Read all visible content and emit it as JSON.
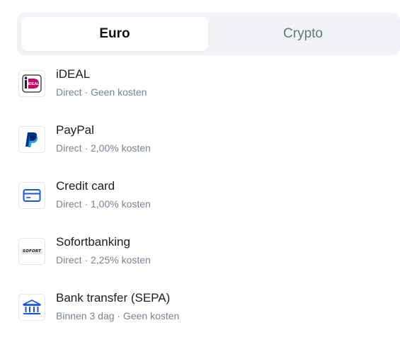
{
  "tabs": {
    "euro": "Euro",
    "crypto": "Crypto",
    "active": "Euro"
  },
  "methods": [
    {
      "title": "iDEAL",
      "subtitle": "Direct · Geen kosten",
      "icon": "ideal-icon",
      "icon_text": "iDEAL"
    },
    {
      "title": "PayPal",
      "subtitle": "Direct · 2,00% kosten",
      "icon": "paypal-icon"
    },
    {
      "title": "Credit card",
      "subtitle": "Direct · 1,00% kosten",
      "icon": "credit-card-icon"
    },
    {
      "title": "Sofortbanking",
      "subtitle": "Direct · 2,25% kosten",
      "icon": "sofort-icon",
      "icon_text": "SOFORT"
    },
    {
      "title": "Bank transfer (SEPA)",
      "subtitle": "Binnen 3 dag · Geen kosten",
      "icon": "bank-icon"
    }
  ],
  "colors": {
    "ideal_pink": "#cc0066",
    "paypal_dark": "#003087",
    "paypal_light": "#009cde",
    "card_blue": "#1a56db",
    "bank_blue": "#1a56db",
    "tab_bg": "#f1f3f6"
  }
}
